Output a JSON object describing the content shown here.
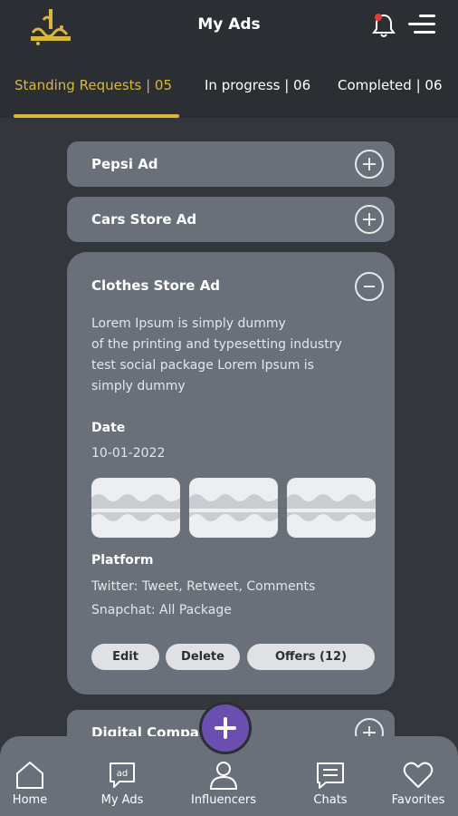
{
  "header": {
    "title": "My Ads"
  },
  "tabs": [
    {
      "label": "Standing Requests | 05"
    },
    {
      "label": "In progress | 06"
    },
    {
      "label": "Completed | 06"
    }
  ],
  "ads": [
    {
      "title": "Pepsi Ad"
    },
    {
      "title": "Cars Store Ad"
    },
    {
      "title": "Clothes Store Ad",
      "description": [
        "Lorem Ipsum is simply dummy",
        "of the printing and typesetting industry",
        "test social package Lorem Ipsum is",
        "simply dummy"
      ],
      "date_label": "Date",
      "date_value": "10-01-2022",
      "platform_label": "Platform",
      "platforms": [
        "Twitter: Tweet, Retweet, Comments",
        "Snapchat: All Package"
      ],
      "actions": {
        "edit": "Edit",
        "delete": "Delete",
        "offers": "Offers (12)"
      }
    },
    {
      "title": "Digital Compa"
    }
  ],
  "nav": [
    {
      "label": "Home",
      "icon": "home-icon"
    },
    {
      "label": "My Ads",
      "icon": "ads-icon"
    },
    {
      "label": "Influencers",
      "icon": "user-icon"
    },
    {
      "label": "Chats",
      "icon": "chat-icon"
    },
    {
      "label": "Favorites",
      "icon": "heart-icon"
    }
  ],
  "colors": {
    "accent": "#d8b83a",
    "card": "#6a7079",
    "background": "#33373c",
    "fab": "#6b4fb0",
    "notification": "#e53935"
  }
}
